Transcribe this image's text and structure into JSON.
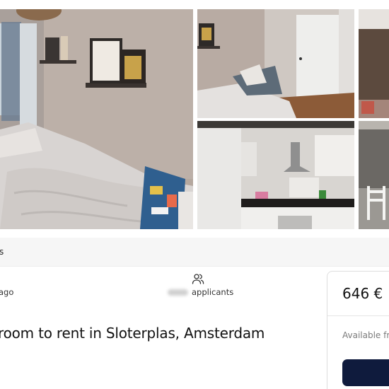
{
  "breadcrumb": {
    "text": "s"
  },
  "meta": {
    "posted": "ago",
    "applicants_label": "applicants"
  },
  "listing": {
    "title": "room to rent in Sloterplas, Amsterdam"
  },
  "price_card": {
    "price": "646 €",
    "available": "Available fr"
  },
  "gallery": {
    "photos": [
      "bedroom-bed",
      "bedroom-door",
      "bedroom-corner",
      "kitchen",
      "dining-chair"
    ]
  },
  "colors": {
    "cta": "#0f1b3d",
    "crumb_bg": "#f6f6f6",
    "wall": "#b7aaa2"
  },
  "icons": [
    "applicants-icon"
  ]
}
